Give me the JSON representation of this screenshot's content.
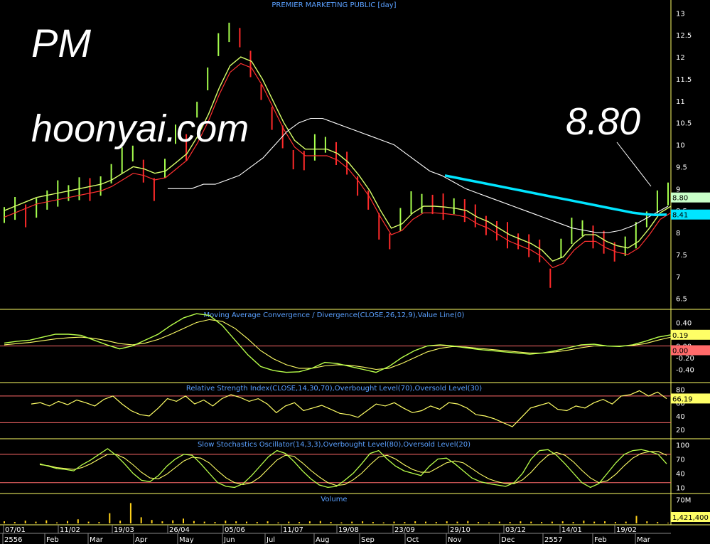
{
  "overlay": {
    "symbol": "PM",
    "site": "hoonyai.com",
    "callout": "8.80"
  },
  "colors": {
    "price_up": "#a6ff4d",
    "price_down": "#ff2a2a",
    "ma_short": "#d8ff6a",
    "ma_mid": "#ff3030",
    "ma_long": "#ffffff",
    "trendline": "#00e5ff",
    "panel_border": "#ffff66",
    "title": "#5aa0ff",
    "axis_text": "#ffffff",
    "ref_line": "#ff6a6a",
    "rsi_line": "#ffff66",
    "stoch_k": "#b8ff4a",
    "stoch_d": "#ffff66",
    "macd_line": "#b8ff4a",
    "signal_line": "#ffff66",
    "volume": "#ffd21a"
  },
  "chart_data": [
    {
      "type": "line",
      "title": "PREMIER MARKETING PUBLIC [day]",
      "ylim": [
        6.3,
        13.2
      ],
      "y_ticks": [
        "6.5",
        "7",
        "7.5",
        "8",
        "8.5",
        "9",
        "9.5",
        "10",
        "10.5",
        "11",
        "11.5",
        "12",
        "12.5",
        "13"
      ],
      "badges": [
        "8.80",
        "8.41"
      ],
      "x_date_labels": [
        "07/01",
        "11/02",
        "19/03",
        "26/04",
        "05/06",
        "11/07",
        "19/08",
        "23/09",
        "29/10",
        "03/12",
        "14/01",
        "19/02"
      ],
      "x_month_labels": [
        "2556",
        "Feb",
        "Mar",
        "Apr",
        "May",
        "Jun",
        "Jul",
        "Aug",
        "Sep",
        "Oct",
        "Nov",
        "Dec",
        "2557",
        "Feb",
        "Mar"
      ],
      "series": [
        {
          "values": [
            8.4,
            8.55,
            8.3,
            8.6,
            8.7,
            8.85,
            8.9,
            9.0,
            8.9,
            9.1,
            9.3,
            9.6,
            9.8,
            9.4,
            8.9,
            9.5,
            10.2,
            9.9,
            10.8,
            11.5,
            12.2,
            12.6,
            12.4,
            11.8,
            11.2,
            10.6,
            10.1,
            9.7,
            9.6,
            9.9,
            10.0,
            9.8,
            9.5,
            9.1,
            8.7,
            8.1,
            7.8,
            8.3,
            8.6,
            8.7,
            8.6,
            8.55,
            8.6,
            8.5,
            8.3,
            8.2,
            8.0,
            7.9,
            7.8,
            7.7,
            7.5,
            7.0,
            7.6,
            8.0,
            8.1,
            7.9,
            7.7,
            7.6,
            7.65,
            7.9,
            8.3,
            8.7,
            8.8
          ]
        },
        {
          "values": [
            8.5,
            8.6,
            8.7,
            8.8,
            8.85,
            8.9,
            8.95,
            9.0,
            9.05,
            9.1,
            9.2,
            9.35,
            9.5,
            9.45,
            9.35,
            9.4,
            9.6,
            9.8,
            10.2,
            10.7,
            11.3,
            11.8,
            12.0,
            11.9,
            11.5,
            11.0,
            10.5,
            10.1,
            9.9,
            9.9,
            9.9,
            9.8,
            9.6,
            9.3,
            8.95,
            8.5,
            8.1,
            8.2,
            8.45,
            8.6,
            8.6,
            8.58,
            8.55,
            8.5,
            8.35,
            8.25,
            8.1,
            7.95,
            7.85,
            7.75,
            7.6,
            7.35,
            7.45,
            7.75,
            7.95,
            7.95,
            7.8,
            7.7,
            7.65,
            7.8,
            8.1,
            8.45,
            8.6
          ]
        },
        {
          "values": [
            9.0,
            9.0,
            9.0,
            9.1,
            9.1,
            9.2,
            9.3,
            9.5,
            9.7,
            10.0,
            10.3,
            10.5,
            10.6,
            10.6,
            10.5,
            10.4,
            10.3,
            10.2,
            10.1,
            10.0,
            9.8,
            9.6,
            9.4,
            9.3,
            9.15,
            9.0,
            8.9,
            8.8,
            8.7,
            8.6,
            8.5,
            8.4,
            8.3,
            8.2,
            8.1,
            8.05,
            8.0,
            8.0,
            8.05,
            8.15,
            8.3,
            8.45,
            8.6
          ]
        },
        {
          "values": [
            9.3,
            9.25,
            9.2,
            9.15,
            9.1,
            9.05,
            9.0,
            8.95,
            8.9,
            8.85,
            8.8,
            8.75,
            8.7,
            8.65,
            8.6,
            8.55,
            8.5,
            8.45,
            8.42,
            8.4,
            8.41
          ]
        }
      ]
    },
    {
      "type": "line",
      "title": "Moving Average Convergence / Divergence(CLOSE,26,12,9),Value Line(0)",
      "ylim": [
        -0.6,
        0.6
      ],
      "y_ticks": [
        "0.40",
        "0.20",
        "0.00",
        "-0.20",
        "-0.40"
      ],
      "badges": [
        "0.19",
        "0.00"
      ],
      "series": [
        {
          "values": [
            0.05,
            0.08,
            0.1,
            0.15,
            0.2,
            0.2,
            0.18,
            0.1,
            0.02,
            -0.05,
            0.0,
            0.1,
            0.2,
            0.35,
            0.48,
            0.55,
            0.52,
            0.35,
            0.1,
            -0.15,
            -0.35,
            -0.42,
            -0.45,
            -0.44,
            -0.38,
            -0.28,
            -0.3,
            -0.35,
            -0.4,
            -0.45,
            -0.35,
            -0.2,
            -0.08,
            0.0,
            0.02,
            0.0,
            -0.03,
            -0.06,
            -0.08,
            -0.1,
            -0.12,
            -0.14,
            -0.12,
            -0.08,
            -0.03,
            0.02,
            0.03,
            0.0,
            -0.01,
            0.02,
            0.08,
            0.15,
            0.19
          ]
        },
        {
          "values": [
            0.02,
            0.04,
            0.06,
            0.09,
            0.12,
            0.14,
            0.15,
            0.13,
            0.09,
            0.04,
            0.02,
            0.05,
            0.11,
            0.2,
            0.3,
            0.4,
            0.45,
            0.42,
            0.3,
            0.12,
            -0.08,
            -0.22,
            -0.32,
            -0.38,
            -0.38,
            -0.34,
            -0.32,
            -0.33,
            -0.36,
            -0.4,
            -0.38,
            -0.3,
            -0.2,
            -0.1,
            -0.04,
            -0.01,
            -0.02,
            -0.04,
            -0.06,
            -0.08,
            -0.1,
            -0.12,
            -0.12,
            -0.1,
            -0.07,
            -0.03,
            0.0,
            0.0,
            0.0,
            0.01,
            0.04,
            0.1,
            0.15
          ]
        },
        {
          "values": [
            0.0,
            0.0
          ]
        }
      ]
    },
    {
      "type": "line",
      "title": "Relative Strength Index(CLOSE,14,30,70),Overbought Level(70),Oversold Level(30)",
      "ylim": [
        8,
        88
      ],
      "y_ticks": [
        "80",
        "60",
        "40",
        "20"
      ],
      "badges": [
        "66.19"
      ],
      "series": [
        {
          "values": [
            58,
            60,
            55,
            62,
            57,
            64,
            60,
            55,
            65,
            70,
            58,
            48,
            42,
            40,
            52,
            66,
            62,
            70,
            58,
            64,
            55,
            66,
            72,
            68,
            62,
            66,
            58,
            45,
            55,
            60,
            48,
            52,
            56,
            50,
            44,
            42,
            38,
            48,
            58,
            55,
            60,
            52,
            45,
            48,
            55,
            50,
            60,
            58,
            52,
            42,
            40,
            36,
            30,
            24,
            38,
            52,
            56,
            60,
            50,
            48,
            55,
            52,
            60,
            65,
            58,
            70,
            72,
            78,
            70,
            76,
            66
          ]
        },
        {
          "values": [
            70,
            70
          ]
        },
        {
          "values": [
            30,
            30
          ]
        }
      ]
    },
    {
      "type": "line",
      "title": "Slow Stochastics Oscillator(14,3,3),Overbought Level(80),Oversold Level(20)",
      "ylim": [
        0,
        110
      ],
      "y_ticks": [
        "100",
        "70",
        "40",
        "10"
      ],
      "series": [
        {
          "values": [
            60,
            55,
            50,
            48,
            45,
            58,
            68,
            80,
            92,
            78,
            60,
            40,
            25,
            22,
            35,
            55,
            70,
            80,
            78,
            60,
            40,
            20,
            12,
            10,
            18,
            35,
            55,
            75,
            88,
            82,
            65,
            45,
            28,
            15,
            10,
            12,
            25,
            40,
            60,
            82,
            88,
            70,
            55,
            45,
            40,
            35,
            55,
            70,
            72,
            60,
            45,
            30,
            22,
            18,
            15,
            12,
            20,
            40,
            70,
            88,
            90,
            78,
            60,
            40,
            20,
            10,
            18,
            40,
            62,
            80,
            88,
            90,
            86,
            80,
            60
          ]
        },
        {
          "values": [
            58,
            56,
            52,
            50,
            48,
            52,
            60,
            70,
            80,
            80,
            72,
            58,
            42,
            30,
            28,
            38,
            52,
            66,
            74,
            72,
            62,
            45,
            30,
            20,
            16,
            20,
            32,
            50,
            68,
            78,
            76,
            62,
            46,
            32,
            20,
            14,
            16,
            26,
            40,
            58,
            74,
            78,
            70,
            58,
            48,
            42,
            42,
            52,
            62,
            66,
            62,
            50,
            38,
            28,
            22,
            18,
            18,
            26,
            42,
            62,
            78,
            84,
            78,
            64,
            46,
            30,
            20,
            24,
            38,
            56,
            72,
            82,
            86,
            86,
            78
          ]
        },
        {
          "values": [
            80,
            80
          ]
        },
        {
          "values": [
            20,
            20
          ]
        }
      ]
    },
    {
      "type": "bar",
      "title": "Volume",
      "ylim": [
        0,
        84
      ],
      "y_ticks": [
        "70M"
      ],
      "badges": [
        "1,421,400"
      ],
      "values": [
        6,
        4,
        8,
        5,
        9,
        3,
        7,
        12,
        5,
        4,
        30,
        8,
        60,
        18,
        10,
        6,
        9,
        14,
        7,
        5,
        4,
        8,
        6,
        5,
        4,
        6,
        3,
        5,
        4,
        6,
        7,
        4,
        3,
        5,
        6,
        4,
        3,
        5,
        4,
        6,
        5,
        4,
        6,
        5,
        7,
        4,
        3,
        5,
        4,
        6,
        5,
        4,
        5,
        6,
        4,
        8,
        5,
        6,
        4,
        5,
        22,
        6,
        4,
        2
      ]
    }
  ]
}
